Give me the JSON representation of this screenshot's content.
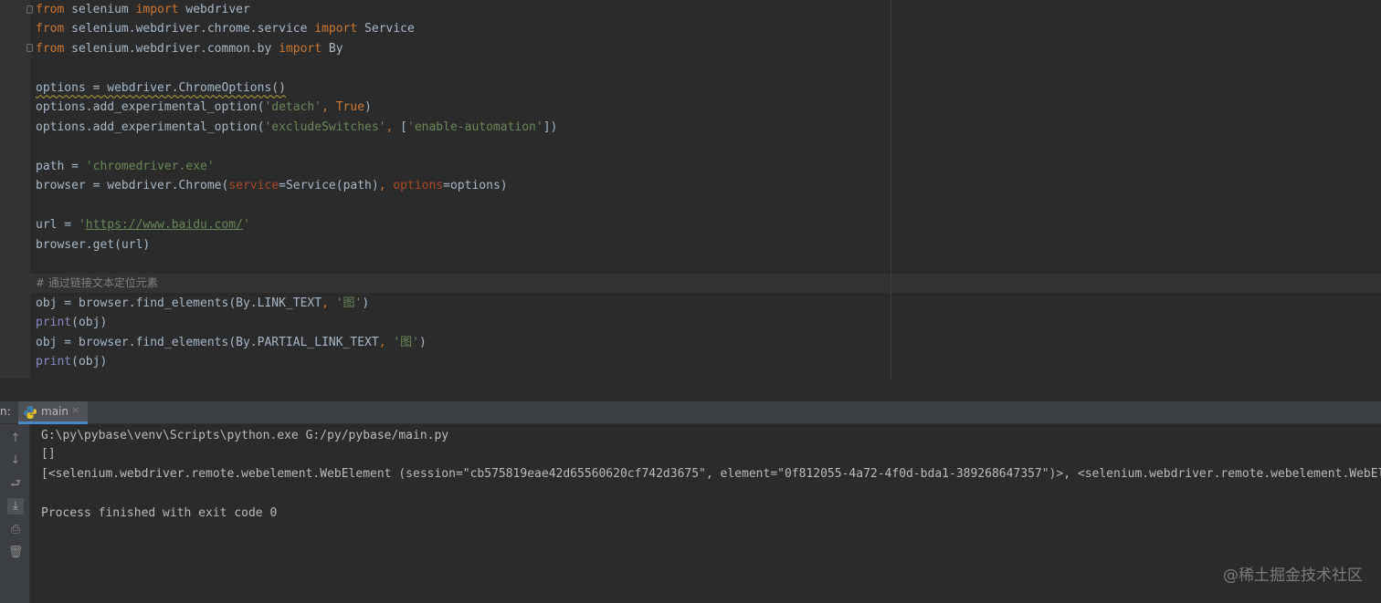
{
  "editor": {
    "lines": {
      "l1_kw1": "from",
      "l1_mod": " selenium ",
      "l1_kw2": "import",
      "l1_name": " webdriver",
      "l2_kw1": "from",
      "l2_mod": " selenium.webdriver.chrome.service ",
      "l2_kw2": "import",
      "l2_name": " Service",
      "l3_kw1": "from",
      "l3_mod": " selenium.webdriver.common.by ",
      "l3_kw2": "import",
      "l3_name": " By",
      "l5_code": "options = webdriver.ChromeOptions()",
      "l6_pre": "options.add_experimental_option(",
      "l6_str": "'detach'",
      "l6_comma": ", ",
      "l6_true": "True",
      "l6_post": ")",
      "l7_pre": "options.add_experimental_option(",
      "l7_str1": "'excludeSwitches'",
      "l7_comma": ", ",
      "l7_br": "[",
      "l7_str2": "'enable-automation'",
      "l7_post": "])",
      "l9_pre": "path = ",
      "l9_str": "'chromedriver.exe'",
      "l10_pre": "browser = webdriver.Chrome(",
      "l10_p1": "service",
      "l10_mid": "=Service(path)",
      "l10_comma": ", ",
      "l10_p2": "options",
      "l10_post": "=options)",
      "l12_pre": "url = ",
      "l12_q1": "'",
      "l12_url": "https://www.baidu.com/",
      "l12_q2": "'",
      "l13_code": "browser.get(url)",
      "l15_comment": "# 通过链接文本定位元素",
      "l16_pre": "obj = browser.find_elements(By.LINK_TEXT",
      "l16_comma": ", ",
      "l16_str": "'图'",
      "l16_post": ")",
      "l17_fn": "print",
      "l17_post": "(obj)",
      "l18_pre": "obj = browser.find_elements(By.PARTIAL_LINK_TEXT",
      "l18_comma": ", ",
      "l18_str": "'图'",
      "l18_post": ")",
      "l19_fn": "print",
      "l19_post": "(obj)"
    }
  },
  "run_panel": {
    "label": "n:",
    "tab_label": "main",
    "tab_close": "×",
    "toolbar_icons": [
      "up-arrow-icon",
      "down-arrow-icon",
      "soft-wrap-icon",
      "scroll-to-end-icon",
      "print-icon",
      "trash-icon"
    ]
  },
  "console": {
    "line1": "G:\\py\\pybase\\venv\\Scripts\\python.exe G:/py/pybase/main.py",
    "line2": "[]",
    "line3": "[<selenium.webdriver.remote.webelement.WebElement (session=\"cb575819eae42d65560620cf742d3675\", element=\"0f812055-4a72-4f0d-bda1-389268647357\")>, <selenium.webdriver.remote.webelement.WebEl",
    "line4": "Process finished with exit code 0"
  },
  "watermark": "@稀土掘金技术社区",
  "colors": {
    "background": "#2b2b2b",
    "keyword": "#cc7832",
    "string": "#6a8759",
    "builtin": "#8888c6",
    "param": "#aa4926",
    "comment": "#808080",
    "text": "#a9b7c6"
  }
}
